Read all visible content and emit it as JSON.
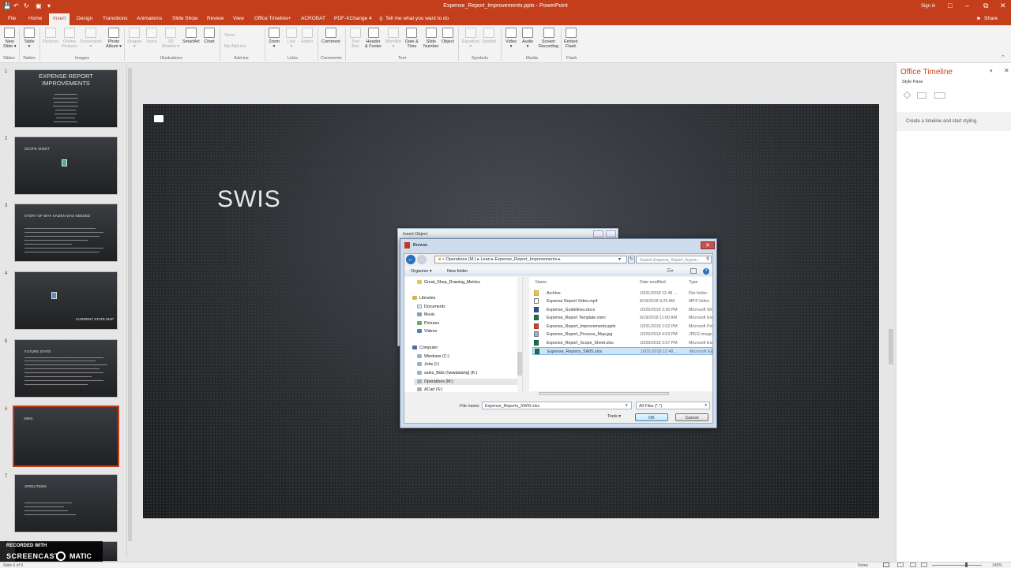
{
  "window": {
    "title": "Expense_Report_Improvements.pptx - PowerPoint",
    "sign_in": "Sign in",
    "share": "Share"
  },
  "tabs": [
    "File",
    "Home",
    "Insert",
    "Design",
    "Transitions",
    "Animations",
    "Slide Show",
    "Review",
    "View",
    "Office Timeline+",
    "ACROBAT",
    "PDF-XChange 4"
  ],
  "tell_me": "Tell me what you want to do",
  "ribbon": {
    "buttons": [
      {
        "label": "New\nSlide ▾",
        "enabled": true
      },
      {
        "label": "Table\n▾",
        "enabled": true
      },
      {
        "label": "Pictures",
        "enabled": false
      },
      {
        "label": "Online\nPictures",
        "enabled": false
      },
      {
        "label": "Screenshot\n▾",
        "enabled": false
      },
      {
        "label": "Photo\nAlbum ▾",
        "enabled": true
      },
      {
        "label": "Shapes\n▾",
        "enabled": false
      },
      {
        "label": "Icons",
        "enabled": false
      },
      {
        "label": "3D\nModels ▾",
        "enabled": false
      },
      {
        "label": "SmartArt",
        "enabled": true
      },
      {
        "label": "Chart",
        "enabled": true
      },
      {
        "label": "Zoom\n▾",
        "enabled": true
      },
      {
        "label": "Link\n▾",
        "enabled": false
      },
      {
        "label": "Action",
        "enabled": false
      },
      {
        "label": "Comment",
        "enabled": true
      },
      {
        "label": "Text\nBox",
        "enabled": false
      },
      {
        "label": "Header\n& Footer",
        "enabled": true
      },
      {
        "label": "WordArt\n▾",
        "enabled": false
      },
      {
        "label": "Date &\nTime",
        "enabled": true
      },
      {
        "label": "Slide\nNumber",
        "enabled": true
      },
      {
        "label": "Object",
        "enabled": true
      },
      {
        "label": "Equation\n▾",
        "enabled": false
      },
      {
        "label": "Symbol",
        "enabled": false
      },
      {
        "label": "Video\n▾",
        "enabled": true
      },
      {
        "label": "Audio\n▾",
        "enabled": true
      },
      {
        "label": "Screen\nRecording",
        "enabled": true
      },
      {
        "label": "Embed\nFlash",
        "enabled": true
      }
    ],
    "addins": {
      "store": "Store",
      "my_addins": "My Add-ins"
    },
    "groups": [
      "Slides",
      "Tables",
      "Images",
      "Illustrations",
      "Add-ins",
      "Links",
      "Comments",
      "Text",
      "Symbols",
      "Media",
      "Flash"
    ]
  },
  "slides": [
    {
      "num": "1",
      "title": "EXPENSE REPORT\nIMPROVEMENTS"
    },
    {
      "num": "2",
      "title": "SCOPE SHEET"
    },
    {
      "num": "3",
      "title": "STORY OF WHY KAIZEN WAS NEEDED"
    },
    {
      "num": "4",
      "title": "CURRENT STATE MAP"
    },
    {
      "num": "5",
      "title": "FUTURE STATE"
    },
    {
      "num": "6",
      "title": "SWIS"
    },
    {
      "num": "7",
      "title": "OPEN ITEMS"
    },
    {
      "num": "8",
      "title": ""
    }
  ],
  "current_slide": {
    "title": "SWIS"
  },
  "taskpane": {
    "title": "Office Timeline",
    "subtitle": "Style Pane",
    "message": "Create a timeline and start styling."
  },
  "insert_object": {
    "title": "Insert Object"
  },
  "browse": {
    "title": "Browse",
    "breadcrumb": [
      "Operations (M:)",
      "Lean",
      "Expense_Report_Improvements"
    ],
    "search_placeholder": "Search Expense_Report_Improv...",
    "toolbar": {
      "organize": "Organize ▾",
      "new_folder": "New folder"
    },
    "nav": [
      {
        "label": "Great_Shop_Drawing_Metrics",
        "indent": 1,
        "icon": "folder"
      },
      {
        "label": "Libraries",
        "indent": 0,
        "icon": "library"
      },
      {
        "label": "Documents",
        "indent": 1,
        "icon": "doc"
      },
      {
        "label": "Music",
        "indent": 1,
        "icon": "music"
      },
      {
        "label": "Pictures",
        "indent": 1,
        "icon": "pic"
      },
      {
        "label": "Videos",
        "indent": 1,
        "icon": "video"
      },
      {
        "label": "Computer",
        "indent": 0,
        "icon": "computer"
      },
      {
        "label": "Windows (C:)",
        "indent": 1,
        "icon": "drive"
      },
      {
        "label": "Jobs (I:)",
        "indent": 1,
        "icon": "drive"
      },
      {
        "label": "sales_Bids (\\\\wwdatahq) (K:)",
        "indent": 1,
        "icon": "drive"
      },
      {
        "label": "Operations (M:)",
        "indent": 1,
        "icon": "drive",
        "selected": true
      },
      {
        "label": "ACad (S:)",
        "indent": 1,
        "icon": "drive"
      }
    ],
    "columns": [
      "Name",
      "Date modified",
      "Type"
    ],
    "files": [
      {
        "name": "Archive",
        "date": "10/31/2018 12:48 ...",
        "type": "File folder",
        "icon": "folder"
      },
      {
        "name": "Expense Report Video.mp4",
        "date": "8/15/2018 9:25 AM",
        "type": "MP4 Video",
        "icon": "video"
      },
      {
        "name": "Expense_Guidelines.docx",
        "date": "10/29/2018 3:30 PM",
        "type": "Microsoft Word",
        "icon": "word"
      },
      {
        "name": "Expense_Report Template.xlsm",
        "date": "9/19/2018 11:00 AM",
        "type": "Microsoft Excel",
        "icon": "excel"
      },
      {
        "name": "Expense_Report_Improvements.pptx",
        "date": "10/31/2018 1:02 PM",
        "type": "Microsoft Powe",
        "icon": "ppt"
      },
      {
        "name": "Expense_Report_Process_Map.jpg",
        "date": "10/29/2018 4:03 PM",
        "type": "JPEG image",
        "icon": "image"
      },
      {
        "name": "Expense_Report_Scope_Sheet.xlsx",
        "date": "10/29/2018 3:57 PM",
        "type": "Microsoft Excel",
        "icon": "excel"
      },
      {
        "name": "Expense_Reports_SWIS.xlsx",
        "date": "10/31/2018 12:48 ...",
        "type": "Microsoft Excel",
        "icon": "excel",
        "selected": true
      }
    ],
    "file_name_label": "File name:",
    "file_name": "Expense_Reports_SWIS.xlsx",
    "file_type": "All Files (*.*)",
    "tools": "Tools ▾",
    "ok": "OK",
    "cancel": "Cancel"
  },
  "status": {
    "slide": "Slide 6 of 9",
    "notes": "Notes",
    "zoom": "145%"
  },
  "watermark": {
    "line1": "RECORDED WITH",
    "line2": "SCREENCAST",
    "line3": "MATIC"
  }
}
